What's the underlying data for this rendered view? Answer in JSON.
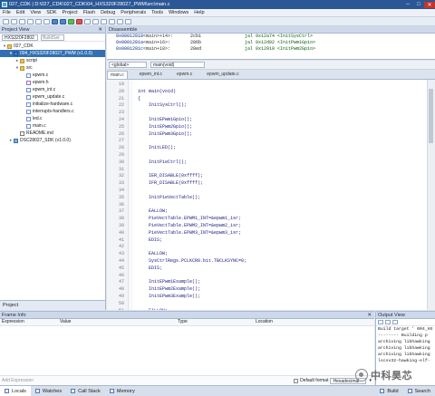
{
  "window": {
    "title": "027_CDK | D:\\027_CDK\\027_CDK\\04_HXS320F28027_PWM\\src\\main.c"
  },
  "menu": [
    "File",
    "Edit",
    "View",
    "SDK",
    "Project",
    "Flash",
    "Debug",
    "Peripherals",
    "Tools",
    "Windows",
    "Help"
  ],
  "project_view": {
    "title": "Project View",
    "chip_select": "HXS320F2802",
    "build_select": "BuildSet",
    "tree": [
      {
        "label": "027_CDK",
        "depth": 0,
        "icon": "folder",
        "twisty": "▾"
      },
      {
        "label": "004_HXS320F28027_PWM (v1.0.0)",
        "depth": 1,
        "icon": "proj",
        "twisty": "▾",
        "selected": true
      },
      {
        "label": "script",
        "depth": 2,
        "icon": "folder",
        "twisty": "▸"
      },
      {
        "label": "src",
        "depth": 2,
        "icon": "folder",
        "twisty": "▾"
      },
      {
        "label": "epwm.c",
        "depth": 3,
        "icon": "cfile"
      },
      {
        "label": "epwm.h",
        "depth": 3,
        "icon": "hfile"
      },
      {
        "label": "epwm_int.c",
        "depth": 3,
        "icon": "cfile"
      },
      {
        "label": "epwm_update.c",
        "depth": 3,
        "icon": "cfile"
      },
      {
        "label": "initialize-hardware.c",
        "depth": 3,
        "icon": "cfile"
      },
      {
        "label": "interrupts-handlers.c",
        "depth": 3,
        "icon": "cfile"
      },
      {
        "label": "led.c",
        "depth": 3,
        "icon": "cfile"
      },
      {
        "label": "main.c",
        "depth": 3,
        "icon": "cfile"
      },
      {
        "label": "README.md",
        "depth": 2,
        "icon": "md"
      },
      {
        "label": "DSC28027_SDK (v1.0.0)",
        "depth": 1,
        "icon": "sdk",
        "twisty": "▸"
      }
    ],
    "bottom_tab": "Project"
  },
  "disassembly": {
    "title": "Disassemble",
    "rows": [
      {
        "addr": "0x00012818",
        "sym": "<main>+14>:",
        "op": "2cb1",
        "ins": "jal 0x12a74 <InitSysCtrl>"
      },
      {
        "addr": "0x0001281a",
        "sym": "<main+16>:",
        "op": "286b",
        "ins": "jal 0x12d02 <InitPwm1Gpio>"
      },
      {
        "addr": "0x0001281c",
        "sym": "<main+18>:",
        "op": "28ed",
        "ins": "jal 0x12910 <InitPwm2Gpio>"
      }
    ]
  },
  "selectors": {
    "scope": "<global>",
    "function": "main(void)"
  },
  "editor_tabs": [
    {
      "label": "main.c",
      "active": true
    },
    {
      "label": "epwm_int.c",
      "active": false
    },
    {
      "label": "epwm.c",
      "active": false
    },
    {
      "label": "epwm_update.c",
      "active": false
    }
  ],
  "code": [
    {
      "n": "19",
      "t": ""
    },
    {
      "n": "20",
      "t": "int main(void)"
    },
    {
      "n": "21",
      "t": "{"
    },
    {
      "n": "22",
      "t": "    InitSysCtrl();"
    },
    {
      "n": "23",
      "t": ""
    },
    {
      "n": "24",
      "t": "    InitEPwm1Gpio();"
    },
    {
      "n": "25",
      "t": "    InitEPwm2Gpio();"
    },
    {
      "n": "26",
      "t": "    InitEPwm3Gpio();"
    },
    {
      "n": "27",
      "t": ""
    },
    {
      "n": "28",
      "t": "    InitLED();"
    },
    {
      "n": "29",
      "t": ""
    },
    {
      "n": "30",
      "t": "    InitPieCtrl();"
    },
    {
      "n": "31",
      "t": ""
    },
    {
      "n": "32",
      "t": "    IER_DISABLE(0xffff);"
    },
    {
      "n": "33",
      "t": "    IFR_DISABLE(0xffff);"
    },
    {
      "n": "34",
      "t": ""
    },
    {
      "n": "35",
      "t": "    InitPieVectTable();"
    },
    {
      "n": "36",
      "t": ""
    },
    {
      "n": "37",
      "t": "    EALLOW;"
    },
    {
      "n": "38",
      "t": "    PieVectTable.EPWM1_INT=&epwm1_isr;"
    },
    {
      "n": "39",
      "t": "    PieVectTable.EPWM2_INT=&epwm2_isr;"
    },
    {
      "n": "40",
      "t": "    PieVectTable.EPWM3_INT=&epwm3_isr;"
    },
    {
      "n": "41",
      "t": "    EDIS;"
    },
    {
      "n": "42",
      "t": ""
    },
    {
      "n": "43",
      "t": "    EALLOW;"
    },
    {
      "n": "44",
      "t": "    SysCtrlRegs.PCLKCR0.bit.TBCLKSYNC=0;"
    },
    {
      "n": "45",
      "t": "    EDIS;"
    },
    {
      "n": "46",
      "t": ""
    },
    {
      "n": "47",
      "t": "    InitEPwm1Example();"
    },
    {
      "n": "48",
      "t": "    InitEPwm2Example();"
    },
    {
      "n": "49",
      "t": "    InitEPwm3Example();"
    },
    {
      "n": "50",
      "t": ""
    },
    {
      "n": "51",
      "t": "    EALLOW;"
    },
    {
      "n": "52",
      "t": "    SysCtrlRegs.PCLKCR0.bit.TBCLKSYNC=1;"
    },
    {
      "n": "53",
      "t": "    EDIS;"
    },
    {
      "n": "54",
      "t": ""
    },
    {
      "n": "55",
      "t": "    IER_ENABLE(M_INT3);"
    },
    {
      "n": "56",
      "t": ""
    },
    {
      "n": "57",
      "t": "    PieCtrlRegs.PIEIER3.bit.INTx1=1;"
    }
  ],
  "frame_info": {
    "title": "Frame Info",
    "columns": [
      "Expression",
      "Value",
      "Type",
      "Location"
    ],
    "add_placeholder": "Add Expression",
    "default_format_label": "Default format",
    "format_value": "Hexadecimal"
  },
  "output_view": {
    "title": "Output View",
    "lines": [
      "Build target ' 004_HX",
      "-------- Building p",
      "archiving libhawking",
      "archiving libhawking",
      "archiving libhawking",
      "lscsv32-hawking-elf-"
    ]
  },
  "bottom_tabs": [
    {
      "label": "Locals",
      "active": true
    },
    {
      "label": "Watches",
      "active": false
    },
    {
      "label": "Call Stack",
      "active": false
    },
    {
      "label": "Memory",
      "active": false
    }
  ],
  "bottom_right_tabs": [
    {
      "label": "Build"
    },
    {
      "label": "Search"
    }
  ],
  "watermark": "中科昊芯"
}
